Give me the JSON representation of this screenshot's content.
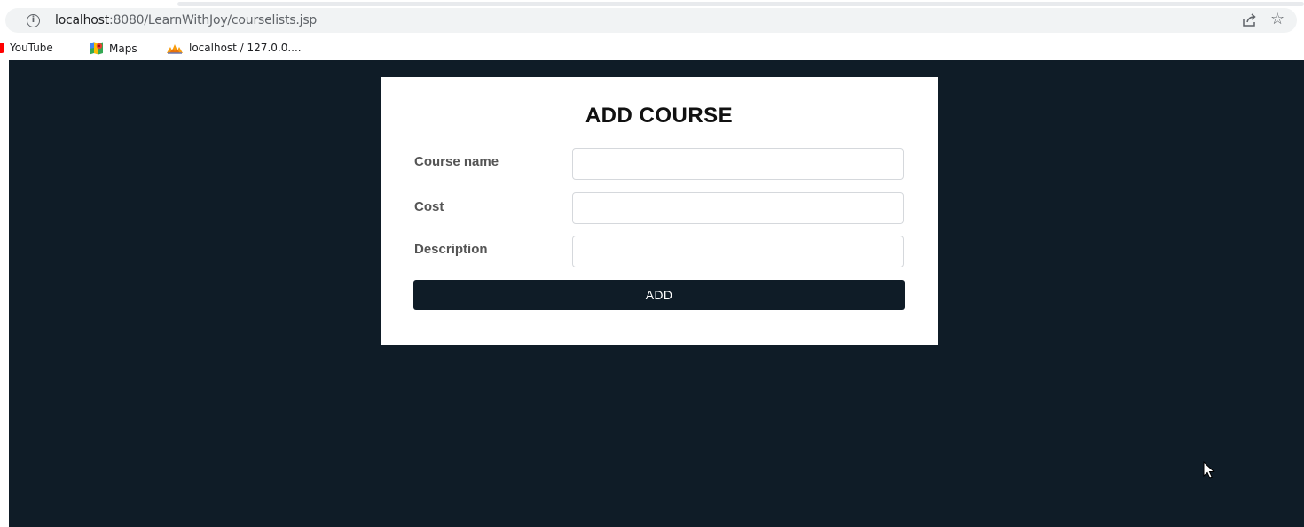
{
  "browser": {
    "url_host": "localhost",
    "url_path": ":8080/LearnWithJoy/courselists.jsp",
    "info_glyph": "i",
    "star_glyph": "☆"
  },
  "bookmarks": [
    {
      "label": "YouTube",
      "icon": "youtube-icon"
    },
    {
      "label": "Maps",
      "icon": "maps-icon"
    },
    {
      "label": "localhost / 127.0.0....",
      "icon": "phpmyadmin-icon"
    }
  ],
  "form": {
    "title": "ADD COURSE",
    "fields": [
      {
        "label": "Course name",
        "value": "",
        "placeholder": ""
      },
      {
        "label": "Cost",
        "value": "",
        "placeholder": ""
      },
      {
        "label": "Description",
        "value": "",
        "placeholder": ""
      }
    ],
    "submit_label": "ADD"
  },
  "colors": {
    "page_background": "#0f1c27",
    "card_background": "#ffffff",
    "button_background": "#0f1c27",
    "button_text": "#ffffff"
  }
}
